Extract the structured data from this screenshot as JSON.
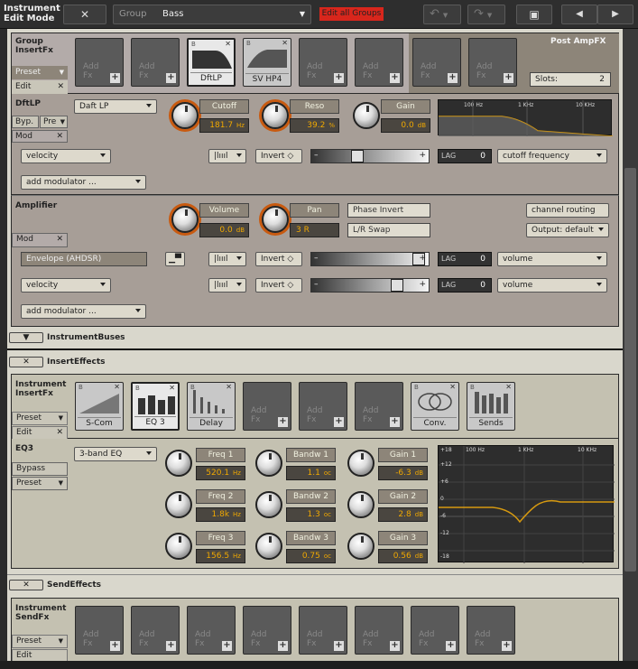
{
  "topbar": {
    "title_line1": "Instrument",
    "title_line2": "Edit Mode",
    "group_label": "Group",
    "group_value": "Bass",
    "edit_all_groups": "Edit all Groups"
  },
  "group_insert": {
    "title_line1": "Group",
    "title_line2": "InsertFx",
    "preset_label": "Preset",
    "edit_label": "Edit",
    "slots": [
      {
        "name": "",
        "add": "Add\nFx"
      },
      {
        "name": "",
        "add": "Add\nFx"
      },
      {
        "name": "DftLP"
      },
      {
        "name": "SV HP4"
      },
      {
        "name": "",
        "add": "Add\nFx"
      },
      {
        "name": "",
        "add": "Add\nFx"
      },
      {
        "name": "",
        "add": "Add\nFx"
      },
      {
        "name": "",
        "add": "Add\nFx"
      }
    ],
    "add_text_a": "Add",
    "add_text_b": "Fx",
    "post_amp_label": "Post AmpFX",
    "slots_label": "Slots:",
    "slots_value": "2"
  },
  "dftlp": {
    "title": "DftLP",
    "byp_label": "Byp.",
    "pre_label": "Pre",
    "mod_label": "Mod",
    "filter_type": "Daft LP",
    "cutoff_label": "Cutoff",
    "cutoff_value": "181.7",
    "cutoff_unit": "Hz",
    "reso_label": "Reso",
    "reso_value": "39.2",
    "reso_unit": "%",
    "gain_label": "Gain",
    "gain_value": "0.0",
    "gain_unit": "dB",
    "graph_ticks": [
      "100 Hz",
      "1 KHz",
      "10 KHz"
    ],
    "mod_row": {
      "source": "velocity",
      "invert": "Invert",
      "lag_label": "LAG",
      "lag_value": "0",
      "target": "cutoff frequency"
    },
    "add_modulator": "add modulator ..."
  },
  "amplifier": {
    "title": "Amplifier",
    "mod_label": "Mod",
    "volume_label": "Volume",
    "volume_value": "0.0",
    "volume_unit": "dB",
    "pan_label": "Pan",
    "pan_value": "3 R",
    "phase_invert": "Phase Invert",
    "lr_swap": "L/R Swap",
    "channel_routing": "channel routing",
    "output": "Output: default",
    "mod_rows": [
      {
        "source": "Envelope (AHDSR)",
        "invert": "Invert",
        "lag_label": "LAG",
        "lag_value": "0",
        "target": "volume"
      },
      {
        "source": "velocity",
        "invert": "Invert",
        "lag_label": "LAG",
        "lag_value": "0",
        "target": "volume"
      }
    ],
    "add_modulator": "add modulator ..."
  },
  "instrument_buses": {
    "label": "InstrumentBuses"
  },
  "insert_effects": {
    "label": "InsertEffects",
    "title_line1": "Instrument",
    "title_line2": "InsertFx",
    "preset_label": "Preset",
    "edit_label": "Edit",
    "slots": [
      {
        "name": "S-Com"
      },
      {
        "name": "EQ 3"
      },
      {
        "name": "Delay"
      },
      {
        "name": ""
      },
      {
        "name": ""
      },
      {
        "name": ""
      },
      {
        "name": "Conv."
      },
      {
        "name": "Sends"
      }
    ]
  },
  "eq3": {
    "title": "EQ3",
    "bypass": "Bypass",
    "preset": "Preset",
    "type": "3-band EQ",
    "bands": [
      {
        "freq_label": "Freq 1",
        "freq_value": "520.1",
        "freq_unit": "Hz",
        "bw_label": "Bandw 1",
        "bw_value": "1.1",
        "bw_unit": "oc",
        "gain_label": "Gain 1",
        "gain_value": "-6.3",
        "gain_unit": "dB"
      },
      {
        "freq_label": "Freq 2",
        "freq_value": "1.8k",
        "freq_unit": "Hz",
        "bw_label": "Bandw 2",
        "bw_value": "1.3",
        "bw_unit": "oc",
        "gain_label": "Gain 2",
        "gain_value": "2.8",
        "gain_unit": "dB"
      },
      {
        "freq_label": "Freq 3",
        "freq_value": "156.5",
        "freq_unit": "Hz",
        "bw_label": "Bandw 3",
        "bw_value": "0.75",
        "bw_unit": "oc",
        "gain_label": "Gain 3",
        "gain_value": "0.56",
        "gain_unit": "dB"
      }
    ],
    "graph_db_ticks": [
      "+18",
      "+12",
      "+6",
      "0",
      "-6",
      "-12",
      "-18"
    ],
    "graph_hz_ticks": [
      "100 Hz",
      "1 KHz",
      "10 KHz"
    ]
  },
  "send_effects": {
    "label": "SendEffects",
    "title_line1": "Instrument",
    "title_line2": "SendFx",
    "preset_label": "Preset",
    "edit_label": "Edit"
  },
  "colors": {
    "accent_orange": "#f0a800",
    "edit_all_red": "#d8261c"
  }
}
